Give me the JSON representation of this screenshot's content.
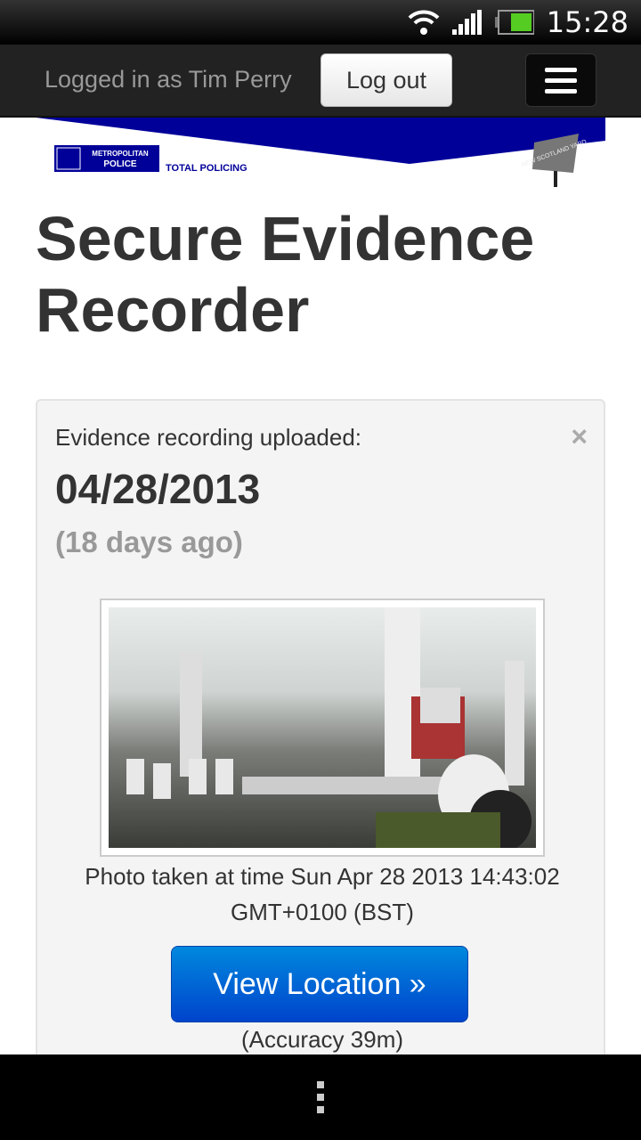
{
  "status_bar": {
    "time": "15:28",
    "icons": [
      "wifi-icon",
      "signal-icon",
      "battery-icon"
    ]
  },
  "navbar": {
    "logged_in_text": "Logged in as Tim Perry",
    "logout_label": "Log out",
    "menu_icon": "hamburger-icon"
  },
  "banner": {
    "org_line1": "METROPOLITAN",
    "org_line2": "POLICE",
    "tagline": "TOTAL POLICING",
    "sign_text": "NEW SCOTLAND YARD",
    "brand_color": "#000099"
  },
  "page_title": "Secure Evidence Recorder",
  "evidence": {
    "label": "Evidence recording uploaded:",
    "close_label": "×",
    "date": "04/28/2013",
    "ago": "(18 days ago)",
    "photo_caption": "Photo taken at time Sun Apr 28 2013 14:43:02 GMT+0100 (BST)",
    "view_location_label": "View Location »",
    "accuracy": "(Accuracy 39m)"
  }
}
